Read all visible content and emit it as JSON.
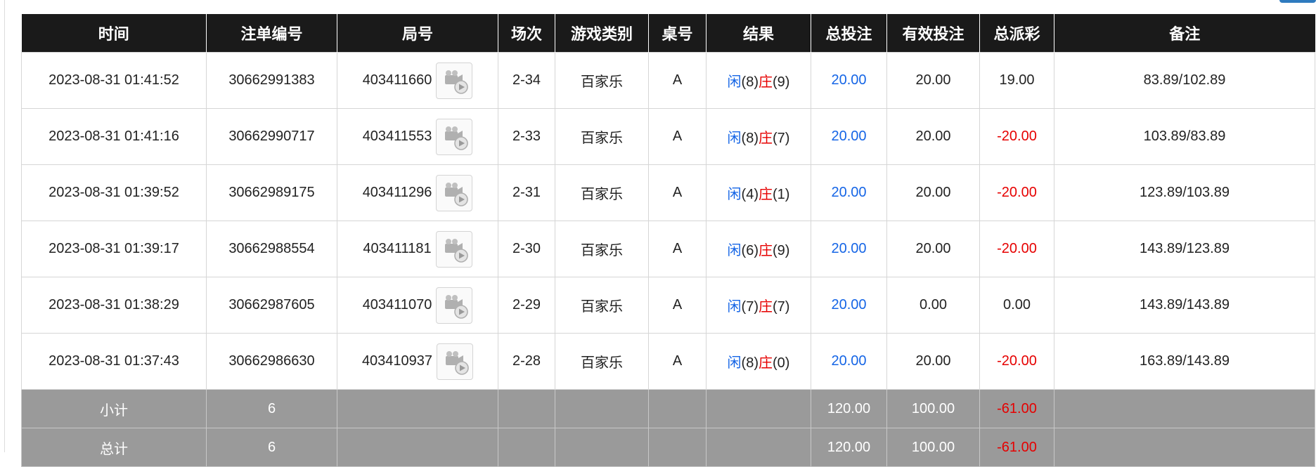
{
  "headers": [
    "时间",
    "注单编号",
    "局号",
    "场次",
    "游戏类别",
    "桌号",
    "结果",
    "总投注",
    "有效投注",
    "总派彩",
    "备注"
  ],
  "rows": [
    {
      "time": "2023-08-31 01:41:52",
      "bet_id": "30662991383",
      "round": "403411660",
      "session": "2-34",
      "game": "百家乐",
      "table": "A",
      "player_label": "闲",
      "player_val": "(8)",
      "banker_label": "庄",
      "banker_val": "(9)",
      "total_bet": "20.00",
      "valid_bet": "20.00",
      "payout": "19.00",
      "payout_negative": false,
      "note": "83.89/102.89"
    },
    {
      "time": "2023-08-31 01:41:16",
      "bet_id": "30662990717",
      "round": "403411553",
      "session": "2-33",
      "game": "百家乐",
      "table": "A",
      "player_label": "闲",
      "player_val": "(8)",
      "banker_label": "庄",
      "banker_val": "(7)",
      "total_bet": "20.00",
      "valid_bet": "20.00",
      "payout": "-20.00",
      "payout_negative": true,
      "note": "103.89/83.89"
    },
    {
      "time": "2023-08-31 01:39:52",
      "bet_id": "30662989175",
      "round": "403411296",
      "session": "2-31",
      "game": "百家乐",
      "table": "A",
      "player_label": "闲",
      "player_val": "(4)",
      "banker_label": "庄",
      "banker_val": "(1)",
      "total_bet": "20.00",
      "valid_bet": "20.00",
      "payout": "-20.00",
      "payout_negative": true,
      "note": "123.89/103.89"
    },
    {
      "time": "2023-08-31 01:39:17",
      "bet_id": "30662988554",
      "round": "403411181",
      "session": "2-30",
      "game": "百家乐",
      "table": "A",
      "player_label": "闲",
      "player_val": "(6)",
      "banker_label": "庄",
      "banker_val": "(9)",
      "total_bet": "20.00",
      "valid_bet": "20.00",
      "payout": "-20.00",
      "payout_negative": true,
      "note": "143.89/123.89"
    },
    {
      "time": "2023-08-31 01:38:29",
      "bet_id": "30662987605",
      "round": "403411070",
      "session": "2-29",
      "game": "百家乐",
      "table": "A",
      "player_label": "闲",
      "player_val": "(7)",
      "banker_label": "庄",
      "banker_val": "(7)",
      "total_bet": "20.00",
      "valid_bet": "0.00",
      "payout": "0.00",
      "payout_negative": false,
      "note": "143.89/143.89"
    },
    {
      "time": "2023-08-31 01:37:43",
      "bet_id": "30662986630",
      "round": "403410937",
      "session": "2-28",
      "game": "百家乐",
      "table": "A",
      "player_label": "闲",
      "player_val": "(8)",
      "banker_label": "庄",
      "banker_val": "(0)",
      "total_bet": "20.00",
      "valid_bet": "20.00",
      "payout": "-20.00",
      "payout_negative": true,
      "note": "163.89/143.89"
    }
  ],
  "summary": [
    {
      "label": "小计",
      "count": "6",
      "total_bet": "120.00",
      "valid_bet": "100.00",
      "payout": "-61.00"
    },
    {
      "label": "总计",
      "count": "6",
      "total_bet": "120.00",
      "valid_bet": "100.00",
      "payout": "-61.00"
    }
  ],
  "icons": {
    "replay": "video-replay-icon"
  },
  "colors": {
    "header_bg": "#1a1a1a",
    "summary_bg": "#9a9a9a",
    "player_blue": "#1565e6",
    "banker_red": "#e60000"
  }
}
